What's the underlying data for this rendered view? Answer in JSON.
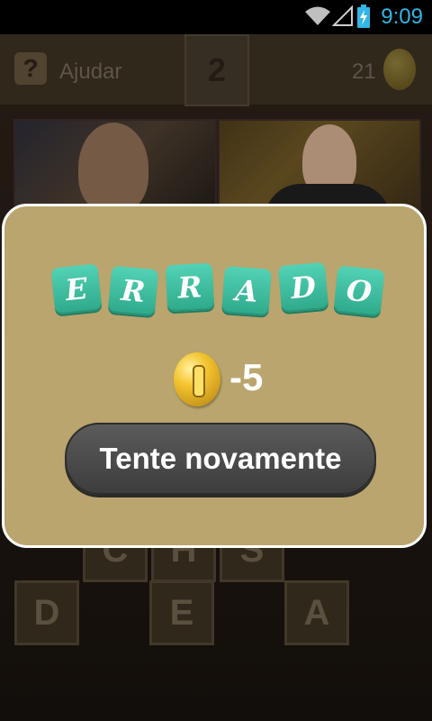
{
  "status": {
    "time": "9:09"
  },
  "header": {
    "help_label": "Ajudar",
    "help_icon": "?",
    "level": "2",
    "coins": "21"
  },
  "answer_slots": [
    "C",
    "H",
    "S"
  ],
  "letters": [
    "D",
    "E",
    "A"
  ],
  "dialog": {
    "word_tiles": [
      "E",
      "R",
      "R",
      "A",
      "D",
      "O"
    ],
    "penalty": "-5",
    "retry_label": "Tente novamente"
  },
  "colors": {
    "dialog_bg": "#b9a56d",
    "tile": "#3cbf9f",
    "button": "#4a4a4a"
  }
}
